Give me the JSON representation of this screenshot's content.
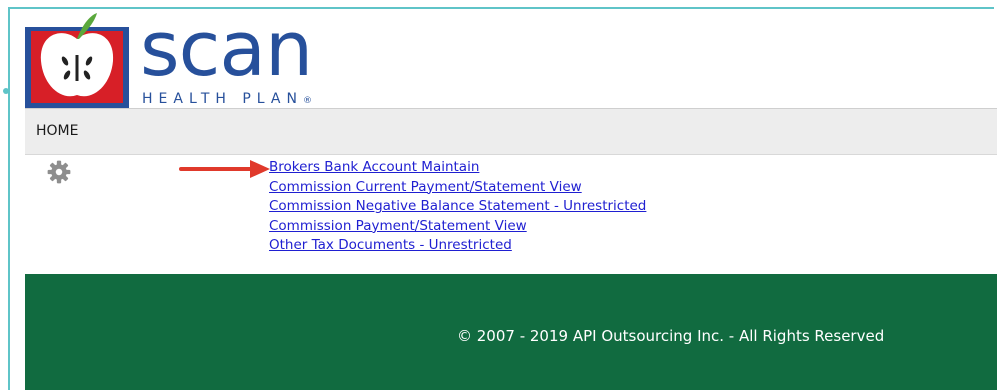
{
  "header": {
    "logo_alt": "SCAN Health Plan",
    "brand_word": "scan",
    "brand_tagline": "HEALTH PLAN",
    "registered_mark": "®"
  },
  "nav": {
    "home_label": "HOME"
  },
  "menu": {
    "settings_icon": "gear-icon",
    "links": [
      "Brokers Bank Account Maintain",
      "Commission Current Payment/Statement View",
      "Commission Negative Balance Statement - Unrestricted",
      "Commission Payment/Statement View",
      "Other Tax Documents - Unrestricted"
    ]
  },
  "annotation": {
    "icon": "red-arrow",
    "color": "#e0392b"
  },
  "footer": {
    "copyright": "© 2007 - 2019 API Outsourcing Inc. - All Rights Reserved"
  },
  "colors": {
    "brand_blue": "#27509b",
    "brand_red": "#d71f27",
    "footer_green": "#116b40",
    "link": "#1f1fd1"
  }
}
